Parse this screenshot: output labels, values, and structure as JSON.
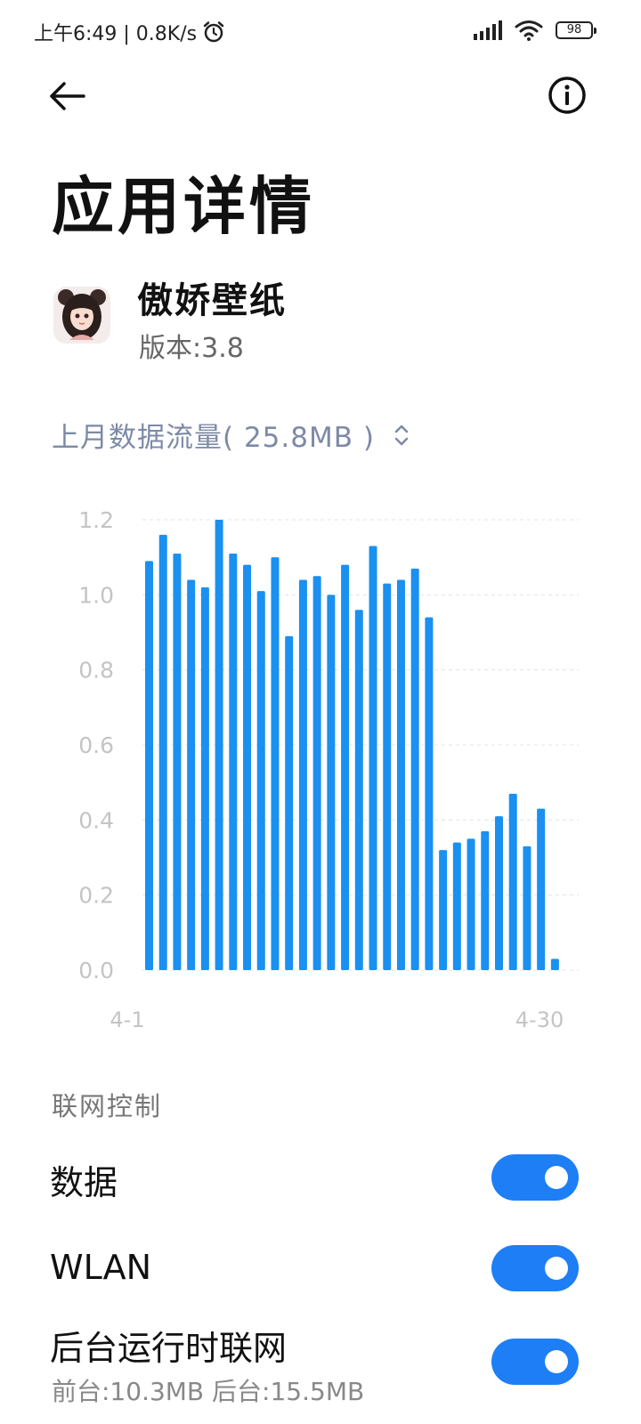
{
  "status_bar": {
    "time_speed": "上午6:49 | 0.8K/s",
    "battery": "98"
  },
  "header": {
    "title": "应用详情"
  },
  "app": {
    "name": "傲娇壁纸",
    "version": "版本:3.8"
  },
  "usage": {
    "label": "上月数据流量( 25.8MB )"
  },
  "chart_data": {
    "type": "bar",
    "y_ticks": [
      "1.2",
      "1.0",
      "0.8",
      "0.6",
      "0.4",
      "0.2",
      "0.0"
    ],
    "ylim": [
      0,
      1.2
    ],
    "grid": true,
    "x_start_label": "4-1",
    "x_end_label": "4-30",
    "bar_color": "#1a90f0",
    "values": [
      1.09,
      1.16,
      1.11,
      1.04,
      1.02,
      1.2,
      1.11,
      1.08,
      1.01,
      1.1,
      0.89,
      1.04,
      1.05,
      1.0,
      1.08,
      0.96,
      1.13,
      1.03,
      1.04,
      1.07,
      0.94,
      0.32,
      0.34,
      0.35,
      0.37,
      0.41,
      0.47,
      0.33,
      0.43,
      0.03
    ]
  },
  "network": {
    "section_title": "联网控制",
    "rows": [
      {
        "label": "数据",
        "enabled": true
      },
      {
        "label": "WLAN",
        "enabled": true
      },
      {
        "label": "后台运行时联网",
        "sub": "前台:10.3MB  后台:15.5MB",
        "enabled": true
      }
    ]
  },
  "colors": {
    "accent": "#1e7ef5",
    "usage_label": "#7d8aa6"
  }
}
